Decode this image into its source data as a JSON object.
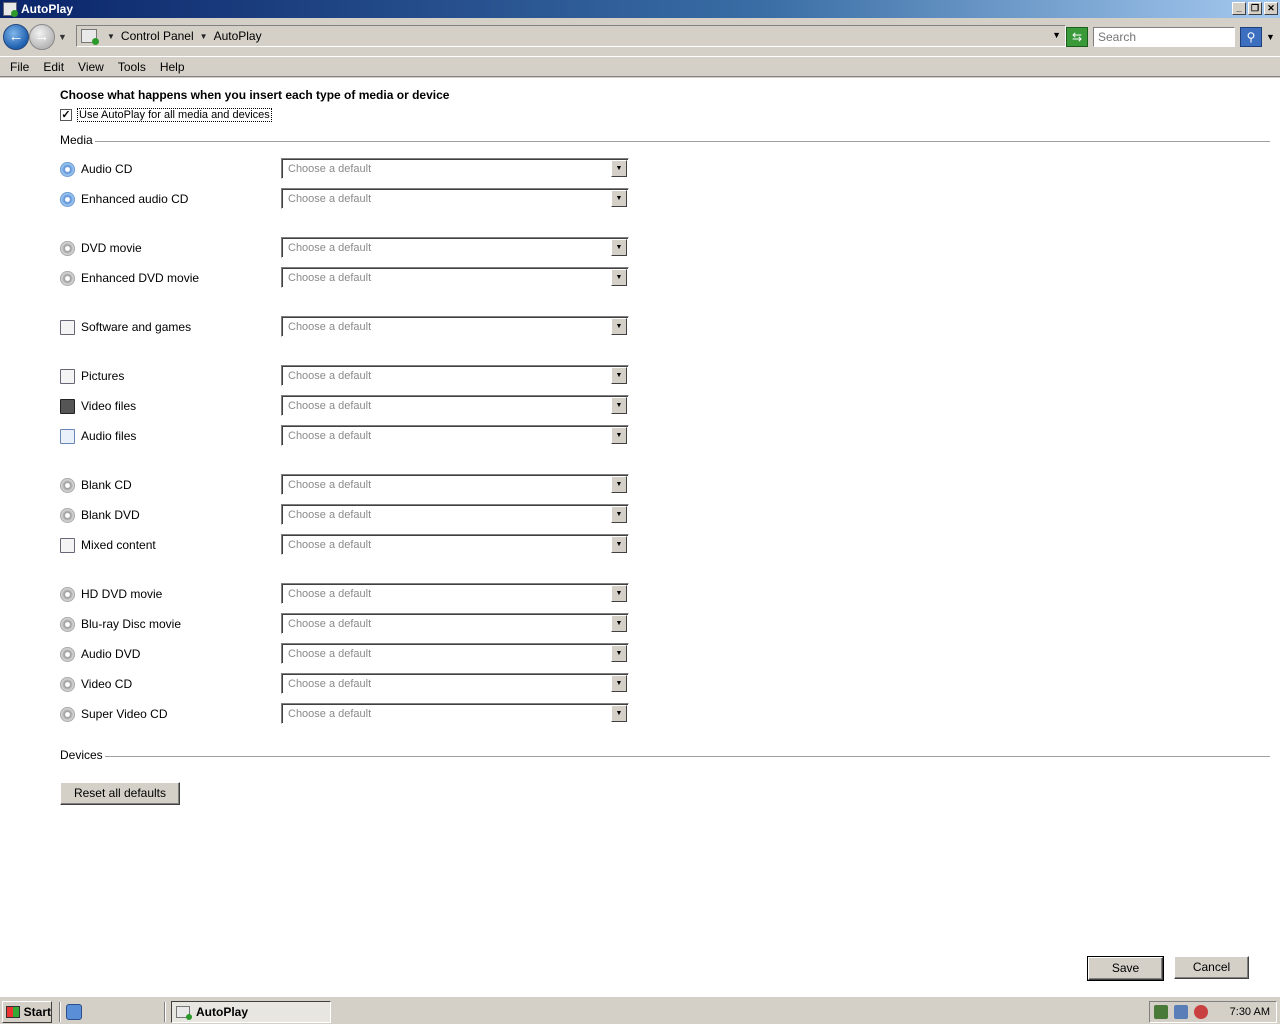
{
  "window": {
    "title": "AutoPlay"
  },
  "address": {
    "crumbs": [
      "Control Panel",
      "AutoPlay"
    ],
    "search_placeholder": "Search"
  },
  "menu": [
    "File",
    "Edit",
    "View",
    "Tools",
    "Help"
  ],
  "content": {
    "heading": "Choose what happens when you insert each type of media or device",
    "use_autoplay_label": "Use AutoPlay for all media and devices",
    "use_autoplay_checked": true,
    "media_group_label": "Media",
    "devices_group_label": "Devices",
    "select_placeholder": "Choose a default",
    "media_items": [
      {
        "label": "Audio CD",
        "icon": "audio-cd-icon"
      },
      {
        "label": "Enhanced audio CD",
        "icon": "enhanced-audio-cd-icon"
      },
      {
        "label": "DVD movie",
        "icon": "dvd-icon"
      },
      {
        "label": "Enhanced DVD movie",
        "icon": "enhanced-dvd-icon"
      },
      {
        "label": "Software and games",
        "icon": "software-icon"
      },
      {
        "label": "Pictures",
        "icon": "pictures-icon"
      },
      {
        "label": "Video files",
        "icon": "video-files-icon"
      },
      {
        "label": "Audio files",
        "icon": "audio-files-icon"
      },
      {
        "label": "Blank CD",
        "icon": "blank-cd-icon"
      },
      {
        "label": "Blank DVD",
        "icon": "blank-dvd-icon"
      },
      {
        "label": "Mixed content",
        "icon": "mixed-content-icon"
      },
      {
        "label": "HD DVD movie",
        "icon": "hd-dvd-icon"
      },
      {
        "label": "Blu-ray Disc movie",
        "icon": "bluray-icon"
      },
      {
        "label": "Audio DVD",
        "icon": "audio-dvd-icon"
      },
      {
        "label": "Video CD",
        "icon": "video-cd-icon"
      },
      {
        "label": "Super Video CD",
        "icon": "super-video-cd-icon"
      }
    ],
    "reset_label": "Reset all defaults",
    "save_label": "Save",
    "cancel_label": "Cancel"
  },
  "taskbar": {
    "start_label": "Start",
    "task_label": "AutoPlay",
    "clock": "7:30 AM"
  }
}
